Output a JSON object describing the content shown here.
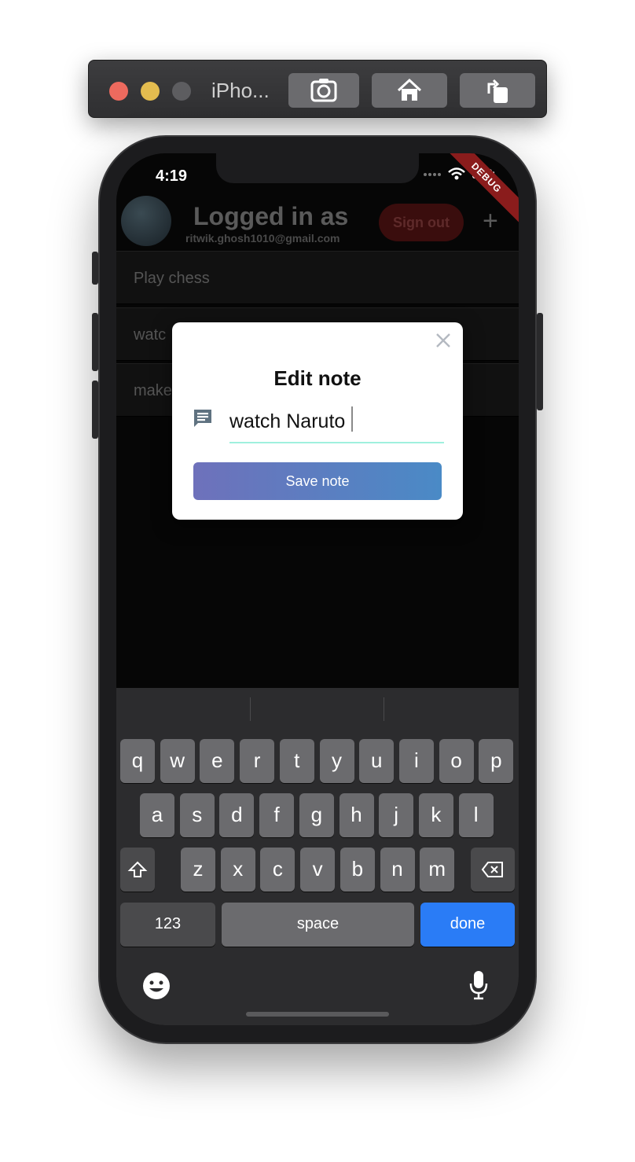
{
  "simulator": {
    "title": "iPho...",
    "buttons": [
      "screenshot-icon",
      "home-icon",
      "rotate-icon"
    ]
  },
  "status_bar": {
    "time": "4:19",
    "debug_label": "DEBUG"
  },
  "app": {
    "header": {
      "title": "Logged in as",
      "email": "ritwik.ghosh1010@gmail.com",
      "signout_label": "Sign out",
      "add_label": "+"
    },
    "notes": [
      "Play chess",
      "watc",
      "make"
    ]
  },
  "dialog": {
    "title": "Edit note",
    "input_value": "watch Naruto",
    "save_label": "Save note",
    "accent_color": "#9ff0de",
    "button_gradient": [
      "#6e71bb",
      "#4a8ac6"
    ]
  },
  "keyboard": {
    "row1": [
      "q",
      "w",
      "e",
      "r",
      "t",
      "y",
      "u",
      "i",
      "o",
      "p"
    ],
    "row2": [
      "a",
      "s",
      "d",
      "f",
      "g",
      "h",
      "j",
      "k",
      "l"
    ],
    "row3": [
      "z",
      "x",
      "c",
      "v",
      "b",
      "n",
      "m"
    ],
    "numbers_label": "123",
    "space_label": "space",
    "done_label": "done",
    "done_color": "#2a7cf6"
  }
}
